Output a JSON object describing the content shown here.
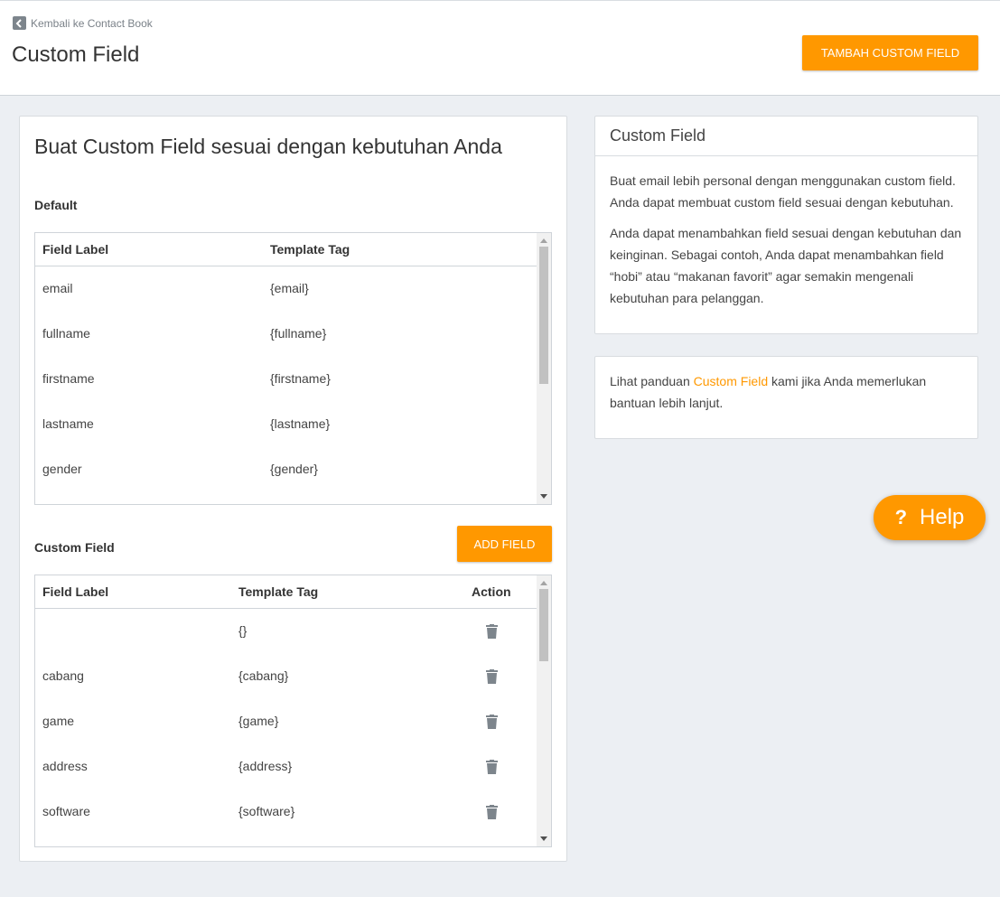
{
  "header": {
    "back_label": "Kembali ke Contact Book",
    "title": "Custom Field",
    "add_button": "TAMBAH CUSTOM FIELD"
  },
  "main": {
    "heading": "Buat Custom Field sesuai dengan kebutuhan Anda",
    "default_section": {
      "label": "Default",
      "columns": [
        "Field Label",
        "Template Tag"
      ],
      "rows": [
        {
          "label": "email",
          "tag": "{email}"
        },
        {
          "label": "fullname",
          "tag": "{fullname}"
        },
        {
          "label": "firstname",
          "tag": "{firstname}"
        },
        {
          "label": "lastname",
          "tag": "{lastname}"
        },
        {
          "label": "gender",
          "tag": "{gender}"
        }
      ]
    },
    "custom_section": {
      "label": "Custom Field",
      "add_button": "ADD FIELD",
      "columns": [
        "Field Label",
        "Template Tag",
        "Action"
      ],
      "rows": [
        {
          "label": "",
          "tag": "{}"
        },
        {
          "label": "cabang",
          "tag": "{cabang}"
        },
        {
          "label": "game",
          "tag": "{game}"
        },
        {
          "label": "address",
          "tag": "{address}"
        },
        {
          "label": "software",
          "tag": "{software}"
        }
      ]
    }
  },
  "info": {
    "title": "Custom Field",
    "p1": "Buat email lebih personal dengan menggunakan custom field. Anda dapat membuat custom field sesuai dengan kebutuhan.",
    "p2": "Anda dapat menambahkan field sesuai dengan kebutuhan dan keinginan. Sebagai contoh, Anda dapat menambahkan field “hobi” atau “makanan favorit” agar semakin mengenali kebutuhan para pelanggan."
  },
  "guide": {
    "before": "Lihat panduan ",
    "link": "Custom Field",
    "after": " kami jika Anda memerlukan bantuan lebih lanjut."
  },
  "help": {
    "icon": "?",
    "label": "Help"
  },
  "colors": {
    "accent": "#ff9800",
    "background": "#eceff3",
    "icon_gray": "#7d858c"
  }
}
